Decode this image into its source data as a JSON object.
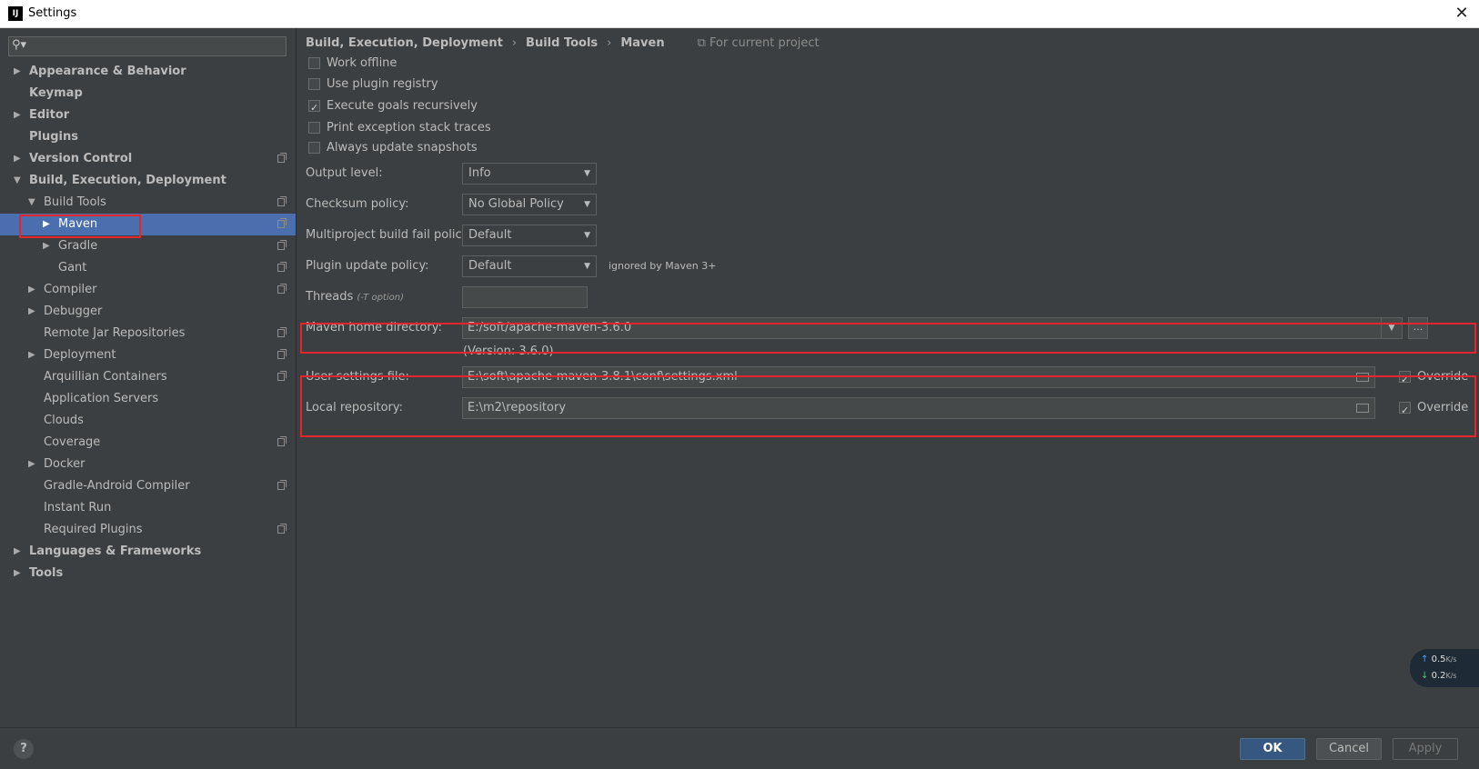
{
  "window": {
    "title": "Settings",
    "app_icon": "IJ",
    "close_label": "✕"
  },
  "search": {
    "placeholder": "",
    "icon": "search-icon"
  },
  "tree": [
    {
      "label": "Appearance & Behavior",
      "arrow": "▶",
      "bold": true
    },
    {
      "label": "Keymap",
      "arrow": "",
      "bold": true
    },
    {
      "label": "Editor",
      "arrow": "▶",
      "bold": true
    },
    {
      "label": "Plugins",
      "arrow": "",
      "bold": true
    },
    {
      "label": "Version Control",
      "arrow": "▶",
      "bold": true,
      "project": true
    },
    {
      "label": "Build, Execution, Deployment",
      "arrow": "▼",
      "bold": true
    },
    {
      "label": "Build Tools",
      "arrow": "▼",
      "project": true
    },
    {
      "label": "Maven",
      "arrow": "▶",
      "project": true,
      "selected": true
    },
    {
      "label": "Gradle",
      "arrow": "▶",
      "project": true
    },
    {
      "label": "Gant",
      "arrow": "",
      "project": true
    },
    {
      "label": "Compiler",
      "arrow": "▶",
      "project": true
    },
    {
      "label": "Debugger",
      "arrow": "▶"
    },
    {
      "label": "Remote Jar Repositories",
      "arrow": "",
      "project": true
    },
    {
      "label": "Deployment",
      "arrow": "▶",
      "project": true
    },
    {
      "label": "Arquillian Containers",
      "arrow": "",
      "project": true
    },
    {
      "label": "Application Servers",
      "arrow": ""
    },
    {
      "label": "Clouds",
      "arrow": ""
    },
    {
      "label": "Coverage",
      "arrow": "",
      "project": true
    },
    {
      "label": "Docker",
      "arrow": "▶"
    },
    {
      "label": "Gradle-Android Compiler",
      "arrow": "",
      "project": true
    },
    {
      "label": "Instant Run",
      "arrow": ""
    },
    {
      "label": "Required Plugins",
      "arrow": "",
      "project": true
    },
    {
      "label": "Languages & Frameworks",
      "arrow": "▶",
      "bold": true
    },
    {
      "label": "Tools",
      "arrow": "▶",
      "bold": true
    }
  ],
  "breadcrumb": {
    "part1": "Build, Execution, Deployment",
    "part2": "Build Tools",
    "part3": "Maven",
    "separator": "›",
    "scope": "For current project"
  },
  "checkboxes": [
    {
      "label": "Work offline",
      "checked": false
    },
    {
      "label": "Use plugin registry",
      "checked": false
    },
    {
      "label": "Execute goals recursively",
      "checked": true
    },
    {
      "label": "Print exception stack traces",
      "checked": false
    },
    {
      "label": "Always update snapshots",
      "checked": false
    }
  ],
  "fields": {
    "output_level": {
      "label": "Output level:",
      "value": "Info"
    },
    "checksum_policy": {
      "label": "Checksum policy:",
      "value": "No Global Policy"
    },
    "multiproject_policy": {
      "label": "Multiproject build fail policy:",
      "value": "Default"
    },
    "plugin_update_policy": {
      "label": "Plugin update policy:",
      "value": "Default",
      "note": "ignored by Maven 3+"
    },
    "threads": {
      "label": "Threads",
      "hint": "(-T option)",
      "value": ""
    },
    "maven_home": {
      "label": "Maven home directory:",
      "value": "E:/soft/apache-maven-3.6.0",
      "version": "(Version: 3.6.0)",
      "browse": "..."
    },
    "user_settings": {
      "label": "User settings file:",
      "value": "E:\\soft\\apache-maven-3.8.1\\conf\\settings.xml",
      "override_label": "Override",
      "override": true
    },
    "local_repo": {
      "label": "Local repository:",
      "value": "E:\\m2\\repository",
      "override_label": "Override",
      "override": true
    }
  },
  "caret": "▼",
  "footer": {
    "help": "?",
    "ok": "OK",
    "cancel": "Cancel",
    "apply": "Apply"
  },
  "network": {
    "up_value": "0.5",
    "down_value": "0.2",
    "unit": "K/s"
  },
  "colors": {
    "background": "#3c3f41",
    "selection": "#4b6eaf",
    "highlight_box": "#e3262b",
    "primary_button": "#365880"
  }
}
